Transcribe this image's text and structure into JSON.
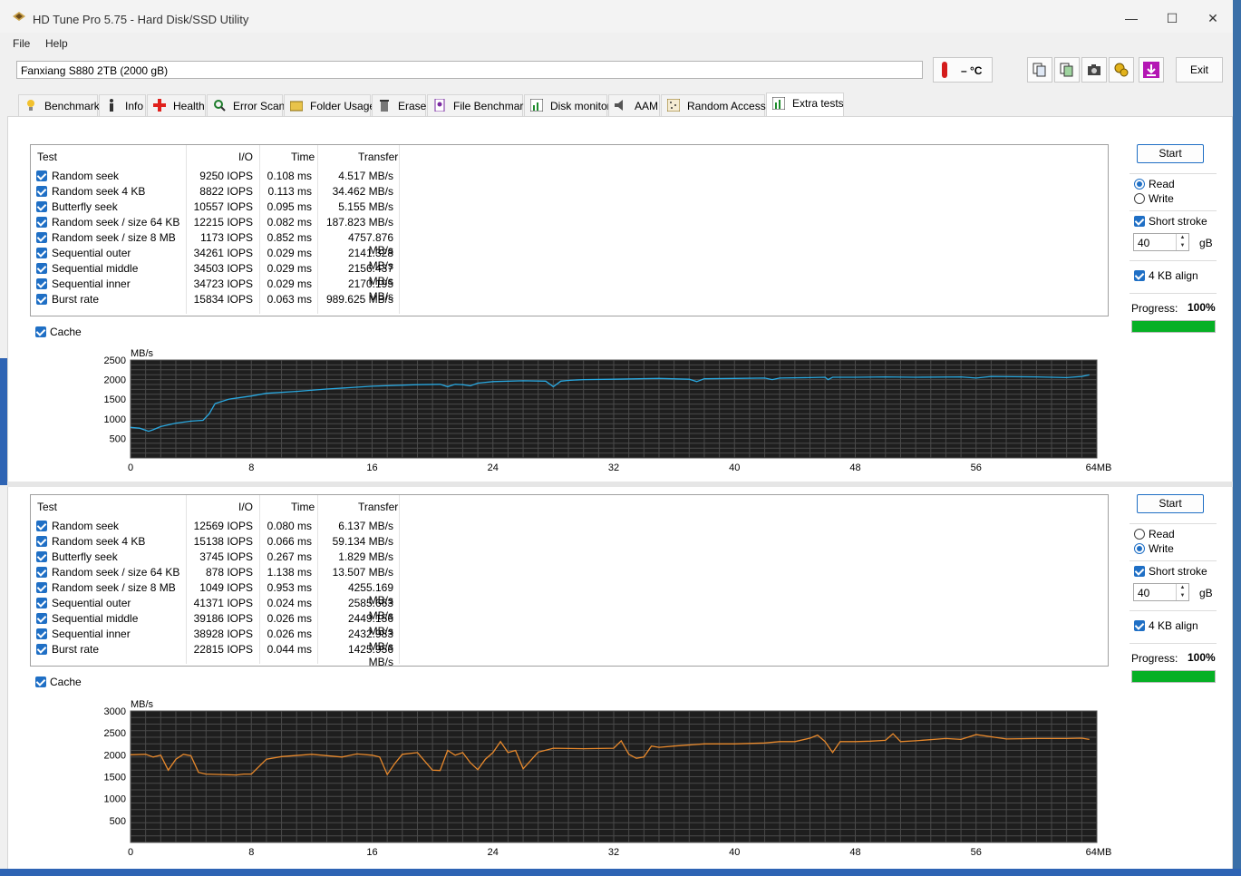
{
  "window": {
    "title": "HD Tune Pro 5.75 - Hard Disk/SSD Utility",
    "minimize": "—",
    "maximize": "☐",
    "close": "✕"
  },
  "menu": [
    "File",
    "Help"
  ],
  "toolbar": {
    "drive": "Fanxiang S880 2TB (2000 gB)",
    "temperature": "– °C",
    "exit_label": "Exit",
    "icons": [
      "copy-text-icon",
      "copy-info-icon",
      "screenshot-icon",
      "options-icon",
      "save-icon"
    ]
  },
  "tabs": [
    {
      "label": "Benchmark",
      "icon": "benchmark-icon"
    },
    {
      "label": "Info",
      "icon": "info-icon"
    },
    {
      "label": "Health",
      "icon": "health-icon"
    },
    {
      "label": "Error Scan",
      "icon": "error-scan-icon"
    },
    {
      "label": "Folder Usage",
      "icon": "folder-icon"
    },
    {
      "label": "Erase",
      "icon": "erase-icon"
    },
    {
      "label": "File Benchmark",
      "icon": "file-benchmark-icon"
    },
    {
      "label": "Disk monitor",
      "icon": "disk-monitor-icon"
    },
    {
      "label": "AAM",
      "icon": "aam-icon"
    },
    {
      "label": "Random Access",
      "icon": "random-access-icon"
    },
    {
      "label": "Extra tests",
      "icon": "extra-tests-icon"
    }
  ],
  "columns": {
    "test": "Test",
    "io": "I/O",
    "time": "Time",
    "transfer": "Transfer"
  },
  "panels": [
    {
      "rows": [
        {
          "name": "Random seek",
          "io": "9250 IOPS",
          "time": "0.108 ms",
          "transfer": "4.517 MB/s"
        },
        {
          "name": "Random seek 4 KB",
          "io": "8822 IOPS",
          "time": "0.113 ms",
          "transfer": "34.462 MB/s"
        },
        {
          "name": "Butterfly seek",
          "io": "10557 IOPS",
          "time": "0.095 ms",
          "transfer": "5.155 MB/s"
        },
        {
          "name": "Random seek / size 64 KB",
          "io": "12215 IOPS",
          "time": "0.082 ms",
          "transfer": "187.823 MB/s"
        },
        {
          "name": "Random seek / size 8 MB",
          "io": "1173 IOPS",
          "time": "0.852 ms",
          "transfer": "4757.876 MB/s"
        },
        {
          "name": "Sequential outer",
          "io": "34261 IOPS",
          "time": "0.029 ms",
          "transfer": "2141.328 MB/s"
        },
        {
          "name": "Sequential middle",
          "io": "34503 IOPS",
          "time": "0.029 ms",
          "transfer": "2156.437 MB/s"
        },
        {
          "name": "Sequential inner",
          "io": "34723 IOPS",
          "time": "0.029 ms",
          "transfer": "2170.195 MB/s"
        },
        {
          "name": "Burst rate",
          "io": "15834 IOPS",
          "time": "0.063 ms",
          "transfer": "989.625 MB/s"
        }
      ],
      "cache_label": "Cache",
      "start_label": "Start",
      "read_label": "Read",
      "write_label": "Write",
      "mode": "read",
      "short_stroke_label": "Short stroke",
      "short_stroke_value": "40",
      "gb_label": "gB",
      "align_label": "4 KB align",
      "progress_label": "Progress:",
      "progress_value": "100%",
      "progress": 1.0
    },
    {
      "rows": [
        {
          "name": "Random seek",
          "io": "12569 IOPS",
          "time": "0.080 ms",
          "transfer": "6.137 MB/s"
        },
        {
          "name": "Random seek 4 KB",
          "io": "15138 IOPS",
          "time": "0.066 ms",
          "transfer": "59.134 MB/s"
        },
        {
          "name": "Butterfly seek",
          "io": "3745 IOPS",
          "time": "0.267 ms",
          "transfer": "1.829 MB/s"
        },
        {
          "name": "Random seek / size 64 KB",
          "io": "878 IOPS",
          "time": "1.138 ms",
          "transfer": "13.507 MB/s"
        },
        {
          "name": "Random seek / size 8 MB",
          "io": "1049 IOPS",
          "time": "0.953 ms",
          "transfer": "4255.169 MB/s"
        },
        {
          "name": "Sequential outer",
          "io": "41371 IOPS",
          "time": "0.024 ms",
          "transfer": "2585.663 MB/s"
        },
        {
          "name": "Sequential middle",
          "io": "39186 IOPS",
          "time": "0.026 ms",
          "transfer": "2449.156 MB/s"
        },
        {
          "name": "Sequential inner",
          "io": "38928 IOPS",
          "time": "0.026 ms",
          "transfer": "2432.983 MB/s"
        },
        {
          "name": "Burst rate",
          "io": "22815 IOPS",
          "time": "0.044 ms",
          "transfer": "1425.956 MB/s"
        }
      ],
      "cache_label": "Cache",
      "start_label": "Start",
      "read_label": "Read",
      "write_label": "Write",
      "mode": "write",
      "short_stroke_label": "Short stroke",
      "short_stroke_value": "40",
      "gb_label": "gB",
      "align_label": "4 KB align",
      "progress_label": "Progress:",
      "progress_value": "100%",
      "progress": 1.0
    }
  ],
  "chart_data": [
    {
      "type": "line",
      "ylabel": "MB/s",
      "ylim": [
        0,
        2500
      ],
      "yticks": [
        500,
        1000,
        1500,
        2000,
        2500
      ],
      "xlim": [
        0,
        64
      ],
      "xticks": [
        "0",
        "8",
        "16",
        "24",
        "32",
        "40",
        "48",
        "56",
        "64MB"
      ],
      "grid": true,
      "color": "#29a8e0",
      "x": [
        0,
        0.6,
        1.2,
        1.5,
        2,
        3,
        4,
        4.8,
        5.2,
        5.6,
        6.5,
        8,
        9,
        11,
        13,
        16,
        19,
        20.5,
        21,
        21.5,
        22,
        22.5,
        23,
        24,
        26,
        27.5,
        28,
        28.5,
        29,
        30,
        32,
        35,
        37,
        37.5,
        38,
        40,
        42,
        42.5,
        43,
        45,
        46,
        46.2,
        46.5,
        48,
        50,
        52,
        55,
        56,
        57,
        60,
        62,
        63,
        63.5
      ],
      "y": [
        780,
        760,
        680,
        720,
        800,
        890,
        940,
        960,
        1120,
        1390,
        1500,
        1580,
        1650,
        1700,
        1760,
        1830,
        1870,
        1880,
        1820,
        1880,
        1870,
        1840,
        1910,
        1950,
        1970,
        1960,
        1820,
        1960,
        1980,
        2000,
        2010,
        2030,
        2010,
        1950,
        2020,
        2030,
        2040,
        2000,
        2040,
        2050,
        2060,
        2000,
        2060,
        2060,
        2070,
        2060,
        2070,
        2040,
        2080,
        2070,
        2050,
        2080,
        2120
      ]
    },
    {
      "type": "line",
      "ylabel": "MB/s",
      "ylim": [
        0,
        3000
      ],
      "yticks": [
        500,
        1000,
        1500,
        2000,
        2500,
        3000
      ],
      "xlim": [
        0,
        64
      ],
      "xticks": [
        "0",
        "8",
        "16",
        "24",
        "32",
        "40",
        "48",
        "56",
        "64MB"
      ],
      "grid": true,
      "color": "#e8892c",
      "x": [
        0,
        1,
        1.5,
        2,
        2.5,
        3,
        3.5,
        4,
        4.5,
        5,
        6,
        7,
        7.5,
        8,
        9,
        10,
        12,
        14,
        15,
        16,
        16.5,
        17,
        17.5,
        18,
        19,
        20,
        20.5,
        21,
        21.5,
        22,
        22.5,
        23,
        23.5,
        24,
        24.5,
        25,
        25.5,
        26,
        27,
        28,
        30,
        32,
        32.5,
        33,
        33.5,
        34,
        34.5,
        35,
        36,
        38,
        40,
        42,
        43,
        44,
        45,
        45.5,
        46,
        46.5,
        47,
        48,
        49,
        50,
        50.5,
        51,
        52,
        54,
        55,
        56,
        58,
        60,
        62,
        63,
        63.5
      ],
      "y": [
        2000,
        2010,
        1950,
        1990,
        1650,
        1900,
        2010,
        1980,
        1600,
        1560,
        1550,
        1540,
        1560,
        1560,
        1900,
        1960,
        2010,
        1950,
        2020,
        1990,
        1950,
        1550,
        1800,
        2010,
        2050,
        1650,
        1640,
        2100,
        1990,
        2050,
        1820,
        1660,
        1900,
        2050,
        2300,
        2050,
        2100,
        1680,
        2060,
        2150,
        2140,
        2150,
        2320,
        2010,
        1920,
        1950,
        2200,
        2170,
        2200,
        2250,
        2250,
        2270,
        2300,
        2300,
        2380,
        2450,
        2300,
        2050,
        2300,
        2300,
        2310,
        2330,
        2480,
        2300,
        2320,
        2370,
        2350,
        2460,
        2360,
        2370,
        2370,
        2380,
        2350,
        2230,
        2380
      ]
    }
  ]
}
